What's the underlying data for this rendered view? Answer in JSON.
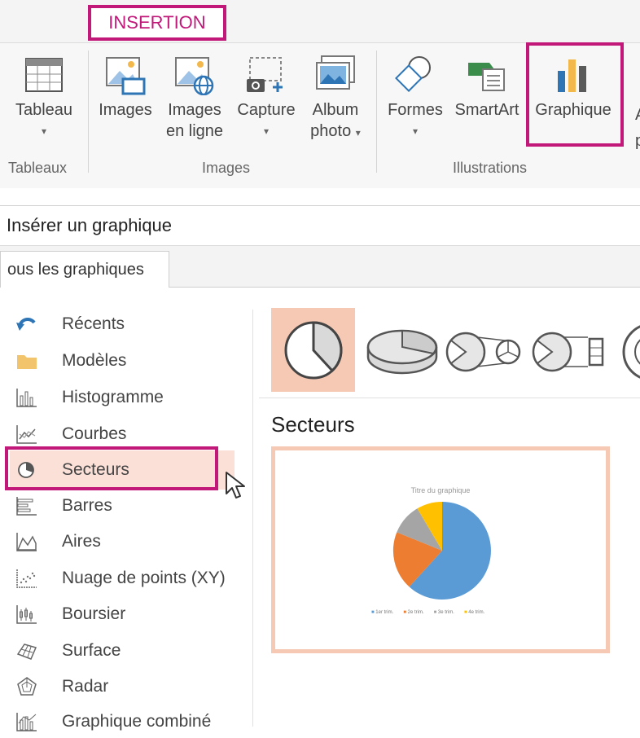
{
  "ribbon": {
    "tab_label": "INSERTION",
    "buttons": {
      "tableau": "Tableau",
      "images": "Images",
      "images_en_ligne_1": "Images",
      "images_en_ligne_2": "en ligne",
      "capture": "Capture",
      "album_1": "Album",
      "album_2": "photo",
      "formes": "Formes",
      "smartart": "SmartArt",
      "graphique": "Graphique"
    },
    "groups": {
      "tableaux": "Tableaux",
      "images": "Images",
      "illustrations": "Illustrations"
    }
  },
  "dialog": {
    "title": "Insérer un graphique",
    "tab": "ous les graphiques",
    "categories": [
      {
        "label": "Récents",
        "icon": "recent-icon"
      },
      {
        "label": "Modèles",
        "icon": "folder-icon"
      },
      {
        "label": "Histogramme",
        "icon": "column-chart-icon"
      },
      {
        "label": "Courbes",
        "icon": "line-chart-icon"
      },
      {
        "label": "Secteurs",
        "icon": "pie-chart-icon"
      },
      {
        "label": "Barres",
        "icon": "bar-chart-icon"
      },
      {
        "label": "Aires",
        "icon": "area-chart-icon"
      },
      {
        "label": "Nuage de points (XY)",
        "icon": "scatter-chart-icon"
      },
      {
        "label": "Boursier",
        "icon": "stock-chart-icon"
      },
      {
        "label": "Surface",
        "icon": "surface-chart-icon"
      },
      {
        "label": "Radar",
        "icon": "radar-chart-icon"
      },
      {
        "label": "Graphique combiné",
        "icon": "combo-chart-icon"
      }
    ],
    "selected_category": "Secteurs",
    "subtype_heading": "Secteurs",
    "preview": {
      "title": "Titre du graphique",
      "legend": [
        "1er trim.",
        "2e trim.",
        "3e trim.",
        "4e trim."
      ],
      "slice_colors": [
        "#5b9bd5",
        "#ed7d31",
        "#a5a5a5",
        "#ffc000"
      ]
    },
    "accent_color": "#c2187a",
    "selection_color": "#f6c9b4"
  }
}
